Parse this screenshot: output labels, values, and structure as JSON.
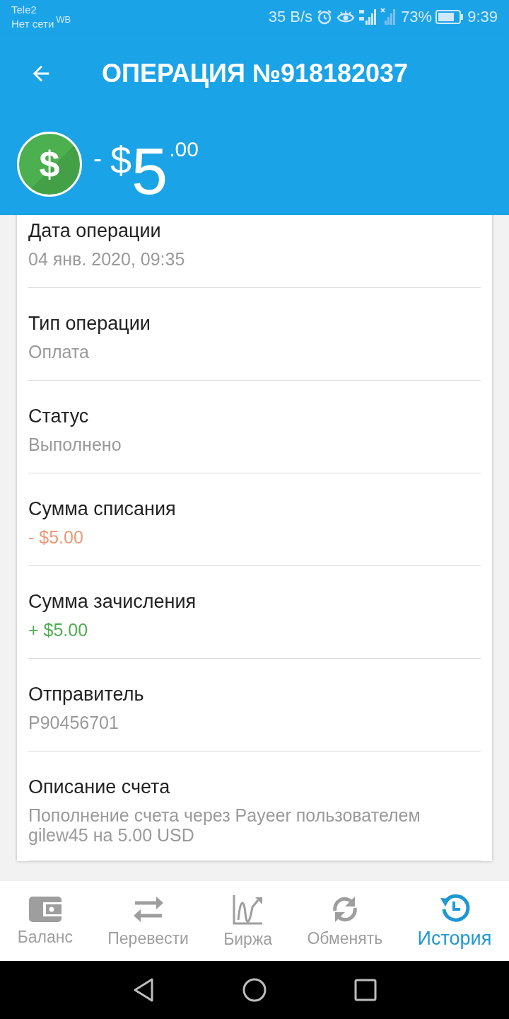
{
  "status_bar": {
    "carrier": "Tele2",
    "network": "Нет сети",
    "network_tag": "WB",
    "speed": "35 B/s",
    "battery_percent": "73%",
    "time": "9:39"
  },
  "toolbar": {
    "title": "ОПЕРАЦИЯ №918182037"
  },
  "amount": {
    "badge_symbol": "$",
    "sign": "-",
    "currency": "$",
    "whole": "5",
    "fraction": ".00"
  },
  "fields": [
    {
      "label": "Дата операции",
      "value": "04 янв. 2020, 09:35",
      "kind": "plain"
    },
    {
      "label": "Тип операции",
      "value": "Оплата",
      "kind": "plain"
    },
    {
      "label": "Статус",
      "value": "Выполнено",
      "kind": "plain"
    },
    {
      "label": "Сумма списания",
      "value": "- $5.00",
      "kind": "debit"
    },
    {
      "label": "Сумма зачисления",
      "value": "+ $5.00",
      "kind": "credit"
    },
    {
      "label": "Отправитель",
      "value": "P90456701",
      "kind": "plain"
    },
    {
      "label": "Описание счета",
      "value": "Пополнение счета через Payeer пользователем gilew45 на 5.00 USD",
      "kind": "plain"
    }
  ],
  "bottom_nav": [
    {
      "label": "Баланс",
      "selected": false
    },
    {
      "label": "Перевести",
      "selected": false
    },
    {
      "label": "Биржа",
      "selected": false
    },
    {
      "label": "Обменять",
      "selected": false
    },
    {
      "label": "История",
      "selected": true
    }
  ]
}
